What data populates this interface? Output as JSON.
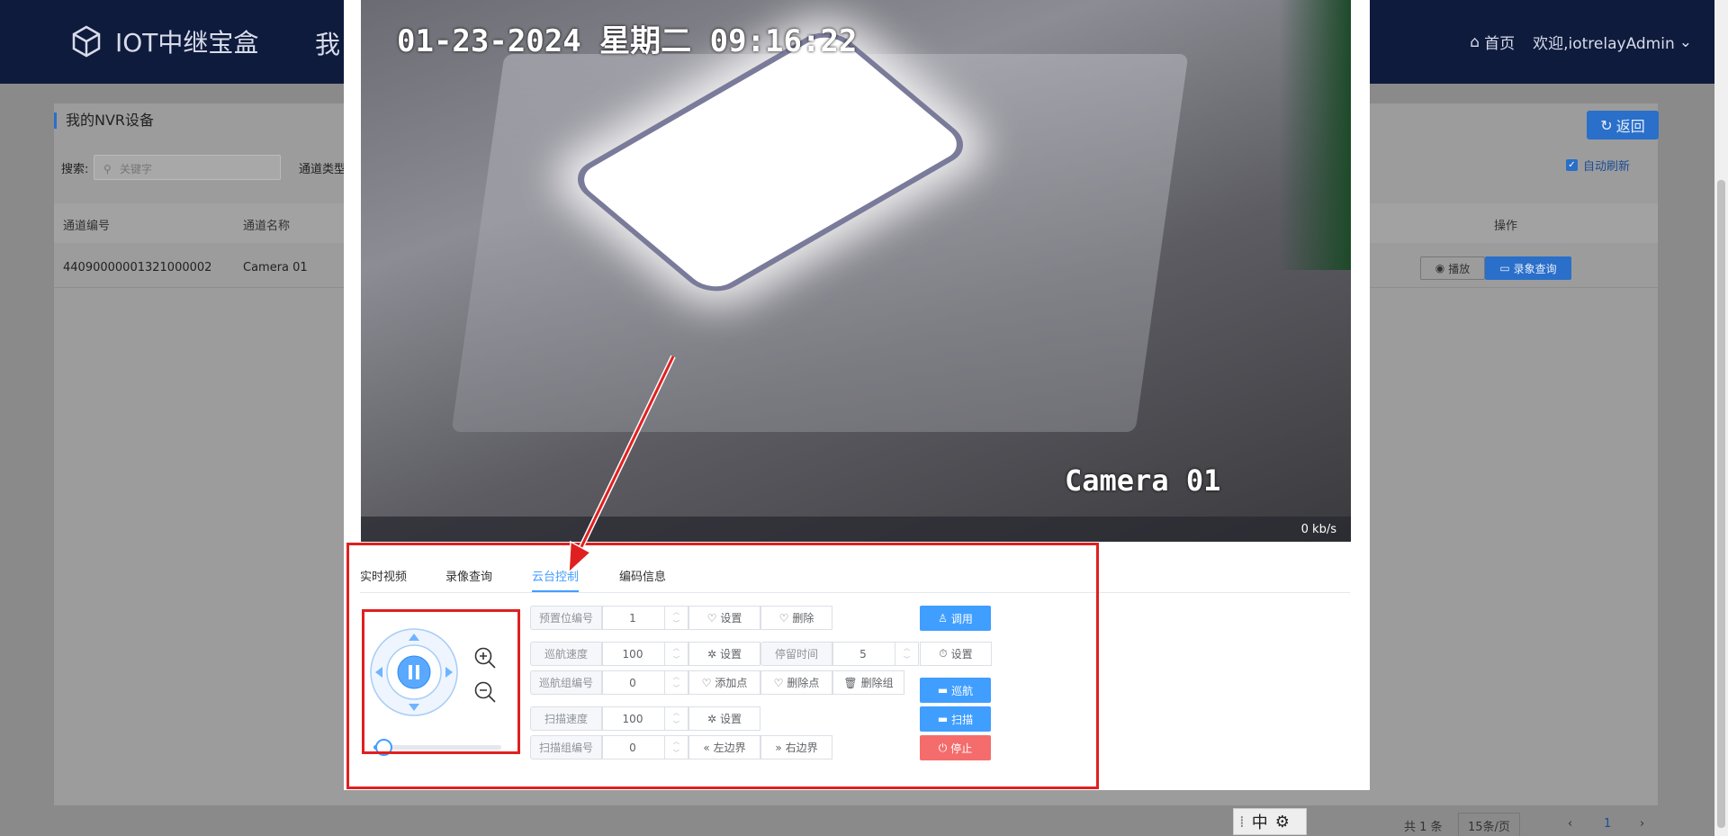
{
  "app": {
    "title": "IOT中继宝盒",
    "nav_partial": "我"
  },
  "header": {
    "home": "首页",
    "welcome": "欢迎,iotrelayAdmin"
  },
  "page": {
    "title": "我的NVR设备",
    "search_label": "搜索:",
    "search_placeholder": "关键字",
    "channel_type_label": "通道类型",
    "back_button": "返回",
    "auto_refresh": "自动刷新",
    "columns": [
      "通道编号",
      "通道名称",
      "操作"
    ],
    "rows": [
      {
        "channel_id": "44090000001321000002",
        "channel_name": "Camera 01",
        "play": "播放",
        "record": "录象查询"
      }
    ],
    "pager": {
      "total": "共 1 条",
      "page_size": "15条/页",
      "current": "1"
    }
  },
  "modal": {
    "video": {
      "timestamp": "01-23-2024  星期二  09:16:22",
      "camera_label": "Camera 01",
      "bitrate": "0 kb/s"
    },
    "tabs": [
      "实时视频",
      "录像查询",
      "云台控制",
      "编码信息"
    ],
    "active_tab": 2,
    "ptz": {
      "preset_label": "预置位编号",
      "preset_value": "1",
      "set": "设置",
      "delete": "删除",
      "call": "调用",
      "cruise_speed_label": "巡航速度",
      "cruise_speed_value": "100",
      "dwell_label": "停留时间",
      "dwell_value": "5",
      "cruise_group_label": "巡航组编号",
      "cruise_group_value": "0",
      "add_point": "添加点",
      "delete_point": "删除点",
      "delete_group": "删除组",
      "cruise": "巡航",
      "scan_speed_label": "扫描速度",
      "scan_speed_value": "100",
      "scan": "扫描",
      "scan_group_label": "扫描组编号",
      "scan_group_value": "0",
      "left_bound": "左边界",
      "right_bound": "右边界",
      "stop": "停止",
      "speed_slider_fraction": 0.08
    }
  },
  "ime": {
    "mode": "中"
  },
  "colors": {
    "primary": "#409eff",
    "danger": "#f56c6c",
    "header": "#0f1b3d",
    "annotation": "#e02020"
  }
}
